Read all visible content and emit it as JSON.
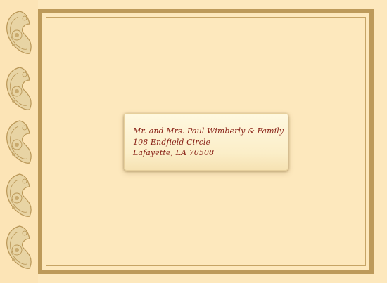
{
  "address": {
    "line1": "Mr. and Mrs. Paul Wimberly & Family",
    "line2": "108 Endfield Circle",
    "line3": "Lafayette, LA 70508"
  },
  "colors": {
    "background": "#fde8bd",
    "frame": "#bd9a5a",
    "ink": "#8a2318",
    "paisley": "#c6a466"
  },
  "decor": {
    "icon": "paisley-icon",
    "count": 5
  }
}
